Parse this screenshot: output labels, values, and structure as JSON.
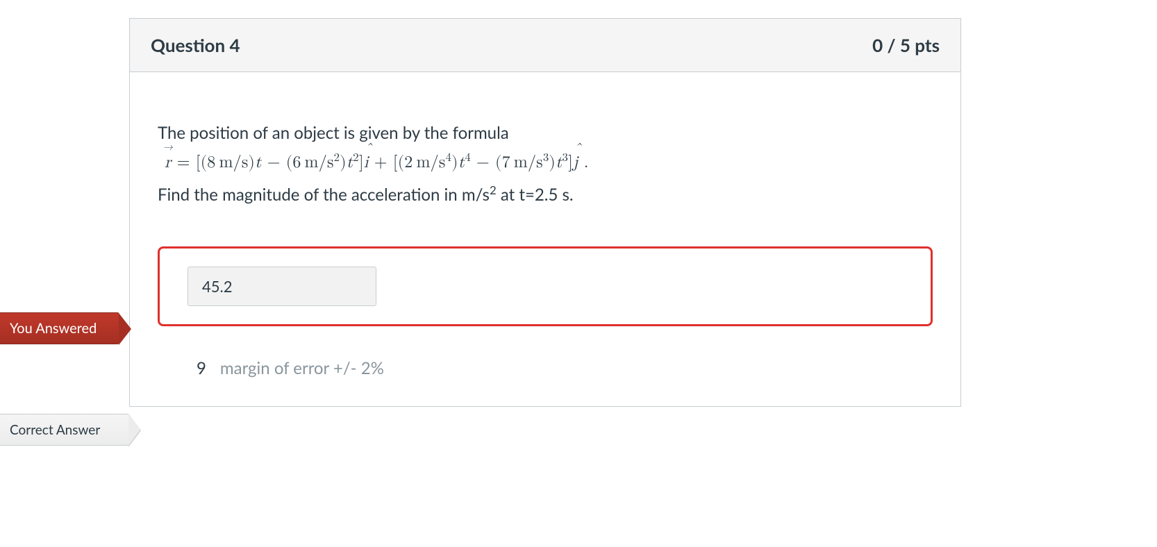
{
  "question": {
    "title": "Question 4",
    "points": "0 / 5 pts",
    "prompt_line1": "The position of an object is given by the formula",
    "formula": {
      "c1": "8",
      "u1": "m/s",
      "c2": "6",
      "u2": "m/s",
      "e2": "2",
      "c3": "2",
      "u3": "m/s",
      "e3": "4",
      "c4": "7",
      "u4": "m/s",
      "e4": "3"
    },
    "prompt_line2_a": "Find the magnitude of the acceleration in m/s",
    "prompt_line2_b": " at t=2.5 s."
  },
  "flags": {
    "you_answered": "You Answered",
    "correct_answer": "Correct Answer"
  },
  "user_answer": {
    "value": "45.2"
  },
  "correct_answer": {
    "value": "9",
    "margin": "margin of error +/- 2%"
  }
}
